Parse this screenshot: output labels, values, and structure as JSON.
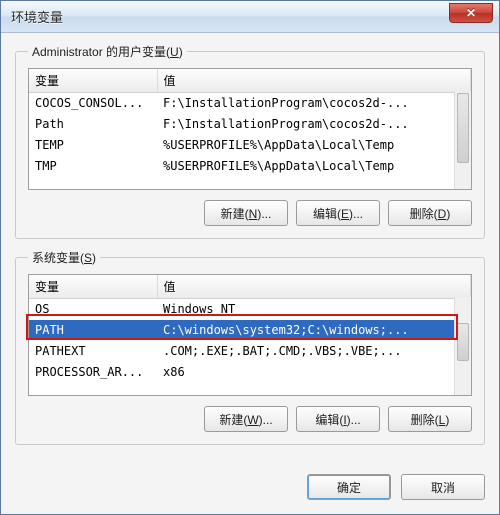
{
  "window": {
    "title": "环境变量"
  },
  "close_glyph": "✕",
  "user_section": {
    "legend_prefix": "Administrator 的用户变量(",
    "legend_key": "U",
    "legend_suffix": ")",
    "col_var": "变量",
    "col_val": "值",
    "rows": [
      {
        "var": "COCOS_CONSOL...",
        "val": "F:\\InstallationProgram\\cocos2d-..."
      },
      {
        "var": "Path",
        "val": "F:\\InstallationProgram\\cocos2d-..."
      },
      {
        "var": "TEMP",
        "val": "%USERPROFILE%\\AppData\\Local\\Temp"
      },
      {
        "var": "TMP",
        "val": "%USERPROFILE%\\AppData\\Local\\Temp"
      }
    ],
    "btn_new": {
      "label": "新建(",
      "key": "N",
      "suffix": ")..."
    },
    "btn_edit": {
      "label": "编辑(",
      "key": "E",
      "suffix": ")..."
    },
    "btn_delete": {
      "label": "删除(",
      "key": "D",
      "suffix": ")"
    }
  },
  "system_section": {
    "legend_prefix": "系统变量(",
    "legend_key": "S",
    "legend_suffix": ")",
    "col_var": "变量",
    "col_val": "值",
    "rows": [
      {
        "var": "OS",
        "val": "Windows_NT"
      },
      {
        "var": "PATH",
        "val": "C:\\windows\\system32;C:\\windows;...",
        "selected": true
      },
      {
        "var": "PATHEXT",
        "val": ".COM;.EXE;.BAT;.CMD;.VBS;.VBE;..."
      },
      {
        "var": "PROCESSOR_AR...",
        "val": "x86"
      }
    ],
    "btn_new": {
      "label": "新建(",
      "key": "W",
      "suffix": ")..."
    },
    "btn_edit": {
      "label": "编辑(",
      "key": "I",
      "suffix": ")..."
    },
    "btn_delete": {
      "label": "删除(",
      "key": "L",
      "suffix": ")"
    }
  },
  "footer": {
    "ok": "确定",
    "cancel": "取消"
  }
}
